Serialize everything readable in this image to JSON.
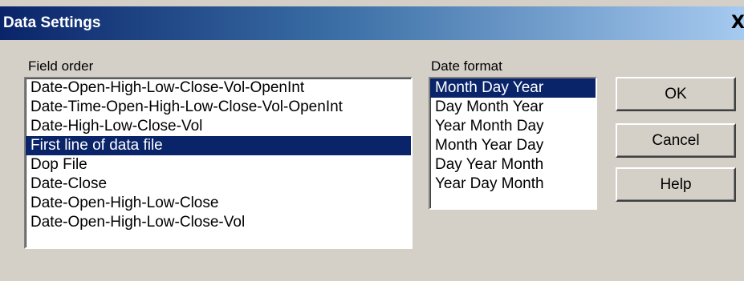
{
  "window": {
    "title": "Data Settings",
    "close_glyph": "X"
  },
  "field_order": {
    "label": "Field order",
    "items": [
      "Date-Open-High-Low-Close-Vol-OpenInt",
      "Date-Time-Open-High-Low-Close-Vol-OpenInt",
      "Date-High-Low-Close-Vol",
      "First line of data file",
      "Dop File",
      "Date-Close",
      "Date-Open-High-Low-Close",
      "Date-Open-High-Low-Close-Vol"
    ],
    "selected_index": 3
  },
  "date_format": {
    "label": "Date format",
    "items": [
      "Month Day Year",
      "Day Month Year",
      "Year Month Day",
      "Month Year Day",
      "Day Year Month",
      "Year Day Month"
    ],
    "selected_index": 0
  },
  "buttons": {
    "ok": "OK",
    "cancel": "Cancel",
    "help": "Help"
  },
  "colors": {
    "selection": "#0a246a",
    "titlebar_start": "#0a246a",
    "titlebar_end": "#a6caf0",
    "dialog_face": "#d4d0c8"
  }
}
